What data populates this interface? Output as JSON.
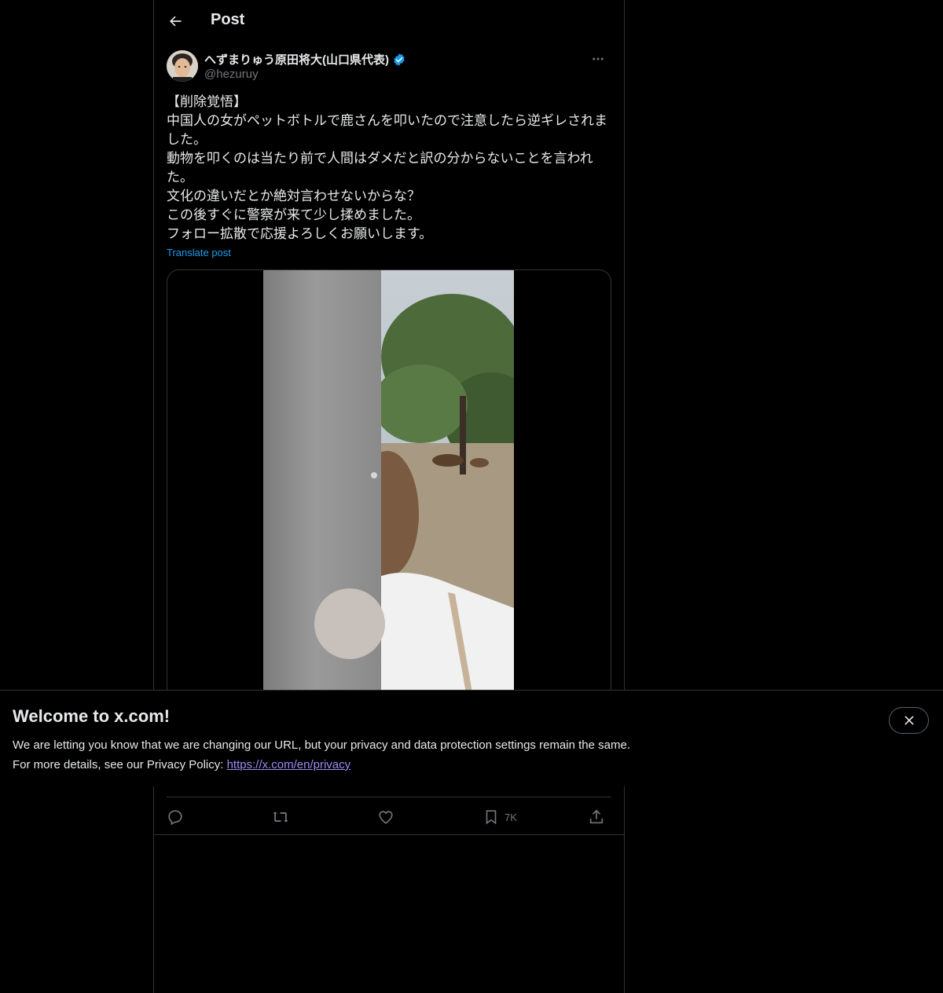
{
  "header": {
    "title": "Post",
    "back_icon": "arrow-left-icon"
  },
  "author": {
    "display_name": "へずまりゅう原田将大(山口県代表)",
    "handle": "@hezuruy",
    "verified": true,
    "verified_color": "#1d9bf0"
  },
  "post": {
    "text": "【削除覚悟】\n中国人の女がペットボトルで鹿さんを叩いたので注意したら逆ギレされました。\n動物を叩くのは当たり前で人間はダメだと訳の分からないことを言われた。\n文化の違いだとか絶対言わせないからな？\nこの後すぐに警察が来て少し揉めました。\nフォロー拡散で応援よろしくお願いします。",
    "translate_label": "Translate post"
  },
  "actions": {
    "reply_icon": "reply-icon",
    "repost_icon": "repost-icon",
    "like_icon": "heart-icon",
    "bookmark_icon": "bookmark-icon",
    "bookmark_count": "7K",
    "share_icon": "share-icon"
  },
  "banner": {
    "title": "Welcome to x.com!",
    "line1": "We are letting you know that we are changing our URL, but your privacy and data protection settings remain the same.",
    "line2_prefix": "For more details, see our Privacy Policy: ",
    "link": "https://x.com/en/privacy",
    "close_icon": "close-icon"
  },
  "colors": {
    "background": "#000000",
    "text": "#e7e9ea",
    "secondary_text": "#71767b",
    "accent": "#1d9bf0",
    "link": "#9b8cf2"
  }
}
